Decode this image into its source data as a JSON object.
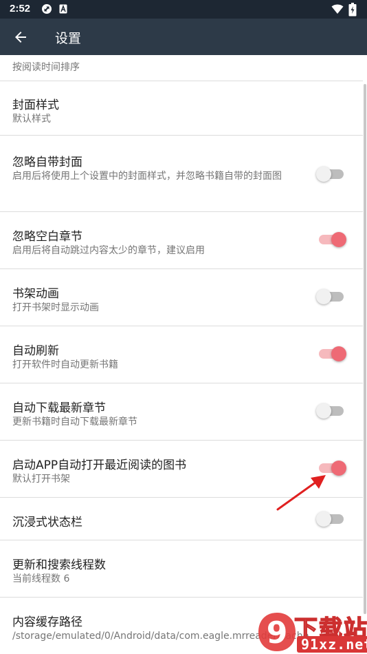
{
  "statusbar": {
    "time": "2:52",
    "icons": [
      "sync-icon",
      "a-badge-icon",
      "wifi-icon",
      "battery-charging-icon"
    ]
  },
  "toolbar": {
    "back_icon": "arrow-left-icon",
    "title": "设置"
  },
  "settings": {
    "items": [
      {
        "title": "",
        "subtitle": "按阅读时间排序"
      },
      {
        "title": "封面样式",
        "subtitle": "默认样式"
      },
      {
        "title": "忽略自带封面",
        "subtitle": "启用后将使用上个设置中的封面样式，并忽略书籍自带的封面图",
        "switch_on": false
      },
      {
        "title": "忽略空白章节",
        "subtitle": "启用后将自动跳过内容太少的章节，建议启用",
        "switch_on": true
      },
      {
        "title": "书架动画",
        "subtitle": "打开书架时显示动画",
        "switch_on": false
      },
      {
        "title": "自动刷新",
        "subtitle": "打开软件时自动更新书籍",
        "switch_on": true
      },
      {
        "title": "自动下载最新章节",
        "subtitle": "更新书籍时自动下载最新章节",
        "switch_on": false
      },
      {
        "title": "启动APP自动打开最近阅读的图书",
        "subtitle": "默认打开书架",
        "switch_on": true
      },
      {
        "title": "沉浸式状态栏",
        "subtitle": "",
        "switch_on": false
      },
      {
        "title": "更新和搜索线程数",
        "subtitle": "当前线程数 6"
      },
      {
        "title": "内容缓存路径",
        "subtitle": "/storage/emulated/0/Android/data/com.eagle.mrreader/cache"
      }
    ]
  },
  "watermark": {
    "logo_text": "9",
    "text": "下载站",
    "domain": "91xz.net"
  },
  "colors": {
    "statusbar": "#1d2733",
    "toolbar": "#2d3a48",
    "accent": "#ee6a75",
    "accent_track": "#f6b9bd",
    "annotation_arrow": "#e02020"
  }
}
